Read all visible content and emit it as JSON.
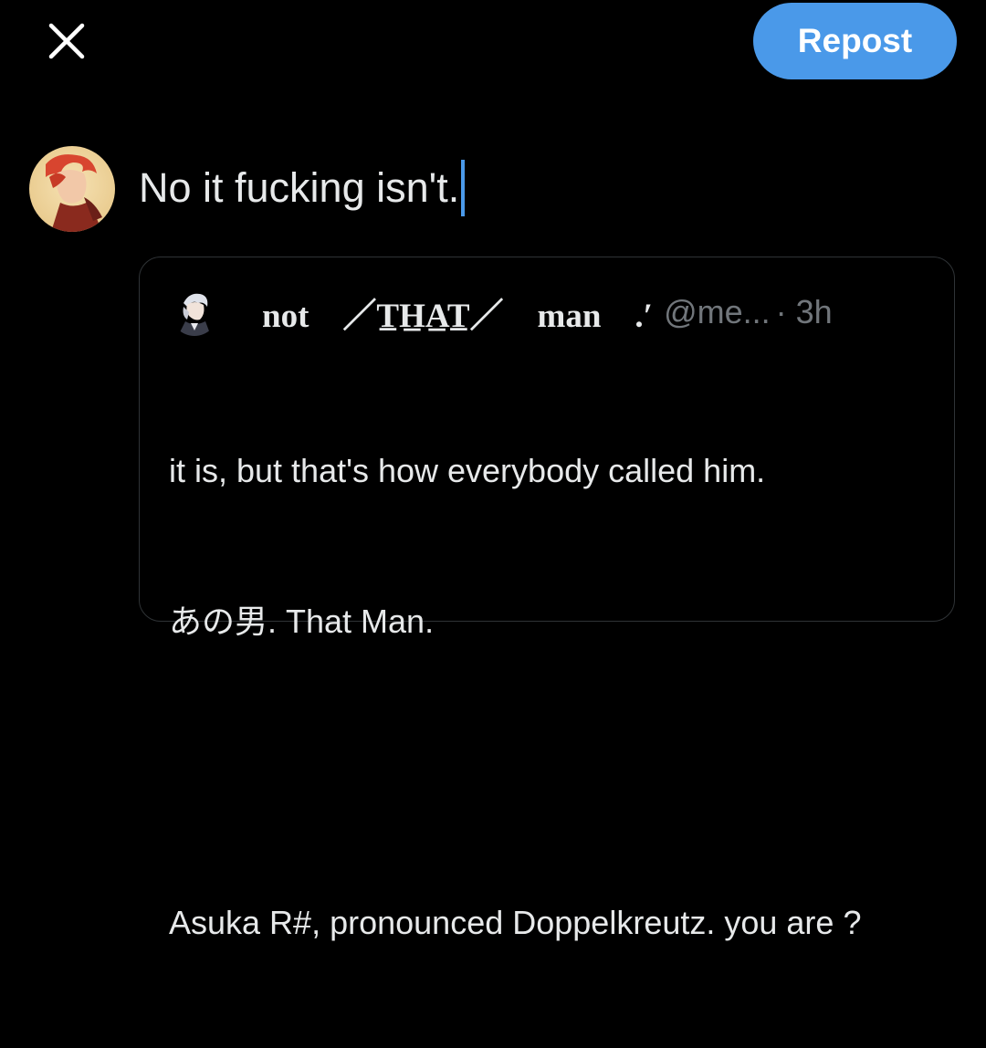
{
  "toolbar": {
    "close_icon": "close-icon",
    "repost_label": "Repost",
    "accent_color": "#4a99e9"
  },
  "compose": {
    "avatar_icon": "user-avatar",
    "text": "No it fucking isn't."
  },
  "quoted_post": {
    "avatar_icon": "quoted-user-avatar",
    "display_name": "not    ／T̲H̲A̲T̲／    man    .′",
    "handle": "@me...",
    "time": "· 3h",
    "body_lines": [
      "it is, but that's how everybody called him.",
      "あの男. That Man.",
      "",
      "Asuka R#, pronounced Doppelkreutz. you are ?"
    ]
  }
}
